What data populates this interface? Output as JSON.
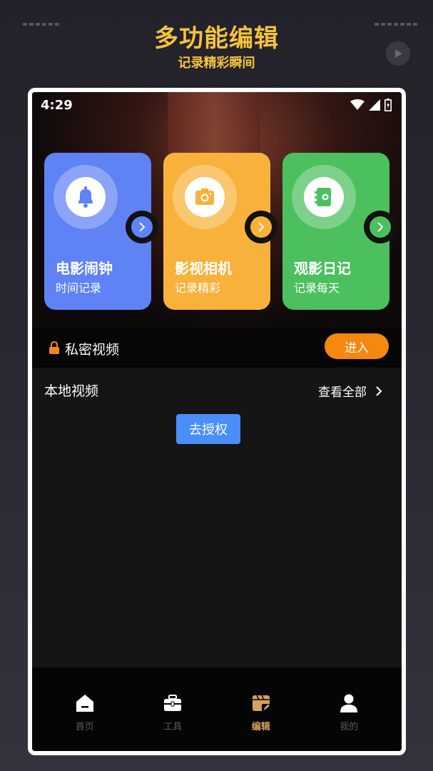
{
  "promo": {
    "title": "多功能编辑",
    "subtitle": "记录精彩瞬间"
  },
  "status_bar": {
    "time": "4:29",
    "icons": [
      "wifi-icon",
      "signal-icon",
      "battery-icon"
    ]
  },
  "feature_cards": [
    {
      "title": "电影闹钟",
      "subtitle": "时间记录",
      "icon": "bell-icon",
      "color": "#5f82f5"
    },
    {
      "title": "影视相机",
      "subtitle": "记录精彩",
      "icon": "camera-icon",
      "color": "#f8b23b"
    },
    {
      "title": "观影日记",
      "subtitle": "记录每天",
      "icon": "diary-icon",
      "color": "#4cc05e"
    }
  ],
  "private_video": {
    "label": "私密视频",
    "button": "进入",
    "icon": "lock-icon"
  },
  "local_video": {
    "title": "本地视频",
    "see_all": "查看全部",
    "auth_button": "去授权"
  },
  "tabbar": {
    "items": [
      {
        "label": "首页",
        "icon": "home-icon",
        "active": false
      },
      {
        "label": "工具",
        "icon": "toolbox-icon",
        "active": false
      },
      {
        "label": "编辑",
        "icon": "edit-icon",
        "active": true
      },
      {
        "label": "我的",
        "icon": "user-icon",
        "active": false
      }
    ]
  },
  "colors": {
    "accent": "#f6c33a",
    "enter_button": "#f5880f",
    "auth_button": "#4a8ef7",
    "tab_active": "#d9a062"
  }
}
